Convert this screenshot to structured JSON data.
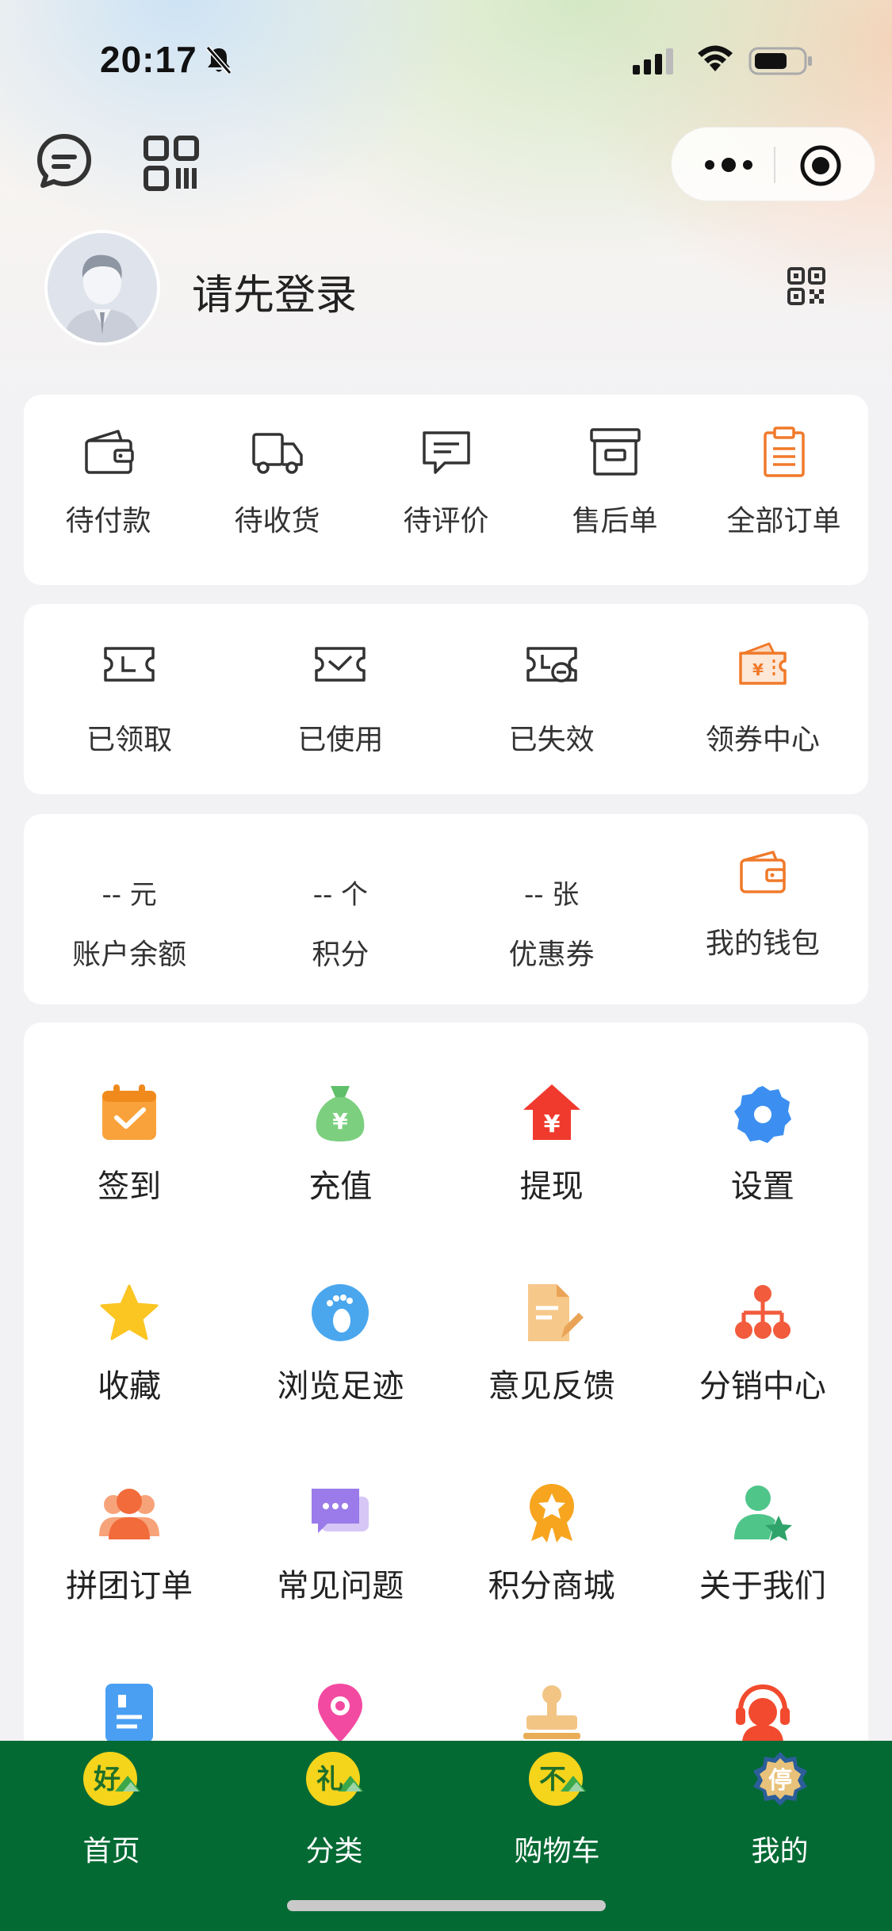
{
  "status_bar": {
    "time": "20:17",
    "icons": [
      "mute-bell-icon",
      "cellular-signal-icon",
      "wifi-icon",
      "battery-icon"
    ]
  },
  "top_nav": {
    "left_icons": [
      "chat-bubble-icon",
      "qr-code-icon"
    ],
    "capsule_icons": [
      "more-dots-icon",
      "close-target-icon"
    ]
  },
  "profile": {
    "login_text": "请先登录",
    "qr_icon": "qr-code-icon"
  },
  "orders": {
    "items": [
      {
        "label": "待付款",
        "icon": "wallet-icon"
      },
      {
        "label": "待收货",
        "icon": "truck-icon"
      },
      {
        "label": "待评价",
        "icon": "comment-icon"
      },
      {
        "label": "售后单",
        "icon": "box-icon"
      },
      {
        "label": "全部订单",
        "icon": "clipboard-icon"
      }
    ]
  },
  "coupons": {
    "items": [
      {
        "label": "已领取",
        "icon": "ticket-received-icon"
      },
      {
        "label": "已使用",
        "icon": "ticket-used-icon"
      },
      {
        "label": "已失效",
        "icon": "ticket-expired-icon"
      },
      {
        "label": "领券中心",
        "icon": "coupon-center-icon"
      }
    ]
  },
  "assets": {
    "items": [
      {
        "value": "-- 元",
        "label": "账户余额"
      },
      {
        "value": "-- 个",
        "label": "积分"
      },
      {
        "value": "-- 张",
        "label": "优惠券"
      }
    ],
    "wallet": {
      "label": "我的钱包",
      "icon": "wallet-card-icon"
    }
  },
  "services": {
    "items": [
      {
        "label": "签到",
        "icon": "calendar-check-icon"
      },
      {
        "label": "充值",
        "icon": "money-bag-icon"
      },
      {
        "label": "提现",
        "icon": "withdraw-house-icon"
      },
      {
        "label": "设置",
        "icon": "settings-gear-icon"
      },
      {
        "label": "收藏",
        "icon": "star-icon"
      },
      {
        "label": "浏览足迹",
        "icon": "footprint-icon"
      },
      {
        "label": "意见反馈",
        "icon": "feedback-doc-icon"
      },
      {
        "label": "分销中心",
        "icon": "org-tree-icon"
      },
      {
        "label": "拼团订单",
        "icon": "group-users-icon"
      },
      {
        "label": "常见问题",
        "icon": "faq-chat-icon"
      },
      {
        "label": "积分商城",
        "icon": "medal-icon"
      },
      {
        "label": "关于我们",
        "icon": "user-star-icon"
      },
      {
        "label": "",
        "icon": "address-book-icon"
      },
      {
        "label": "",
        "icon": "location-pin-icon"
      },
      {
        "label": "",
        "icon": "stamp-icon"
      },
      {
        "label": "",
        "icon": "customer-service-icon"
      }
    ]
  },
  "tabbar": {
    "tabs": [
      {
        "label": "首页",
        "glyph": "好"
      },
      {
        "label": "分类",
        "glyph": "礼"
      },
      {
        "label": "购物车",
        "glyph": "不"
      },
      {
        "label": "我的",
        "glyph": "停"
      }
    ]
  },
  "colors": {
    "tabbar_bg": "#046a34",
    "accent_orange": "#f07a2a",
    "page_bg": "#f2f2f4"
  }
}
